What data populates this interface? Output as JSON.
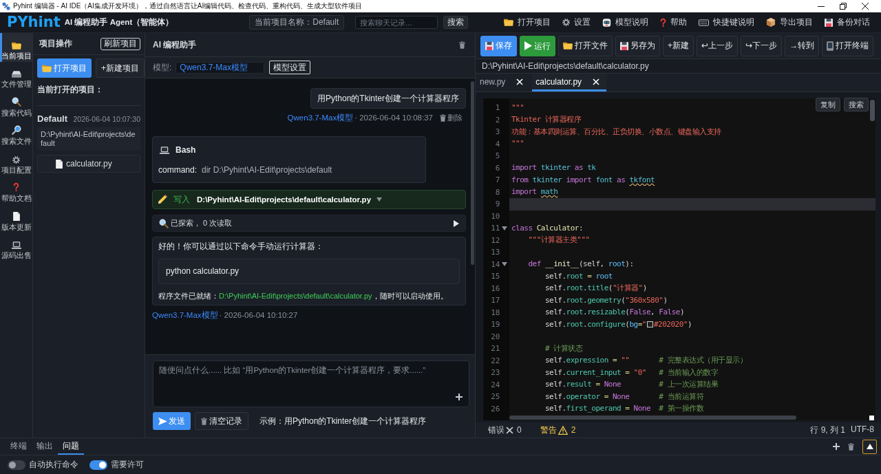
{
  "window": {
    "title": "Pyhint 编辑器 - AI IDE（AI集成开发环境），通过自然语言让AI编辑代码、检查代码、重构代码、生成大型软件项目"
  },
  "header": {
    "logo": "PYhint",
    "subtitle": "AI 编程助手 Agent（智能体）",
    "project_name": "当前项目名称：Default",
    "search": {
      "placeholder": "搜索聊天记录..."
    },
    "search_button": "搜索",
    "menu": [
      "打开项目",
      "设置",
      "模型说明",
      "帮助",
      "快捷键说明",
      "导出项目",
      "备份对话"
    ]
  },
  "sidebar": {
    "items": [
      {
        "label": "当前项目",
        "selected": true
      },
      {
        "label": "文件管理",
        "selected": false
      },
      {
        "label": "搜索代码",
        "selected": false
      },
      {
        "label": "搜索文件",
        "selected": false
      },
      {
        "label": "项目配置",
        "selected": false
      },
      {
        "label": "帮助文档",
        "selected": false
      },
      {
        "label": "版本更新",
        "selected": false
      },
      {
        "label": "源码出售",
        "selected": false
      }
    ]
  },
  "project_panel": {
    "title": "项目操作",
    "refresh_button": "刷新项目",
    "open_button": "打开项目",
    "new_button": "+新建项目",
    "current_label": "当前打开的项目：",
    "project": {
      "name": "Default",
      "time": "2026-06-04 10:07:30",
      "path": "D:\\Pyhint\\AI-Edit\\projects\\default",
      "files": [
        "calculator.py"
      ]
    }
  },
  "chat": {
    "title": "AI 编程助手",
    "model_label": "模型:",
    "model": "Qwen3.7-Max模型",
    "model_settings_button": "模型设置",
    "messages": [
      {
        "kind": "user",
        "text": "用Python的Tkinter创建一个计算器程序",
        "model": "Qwen3.7-Max模型",
        "time": "· 2026-06-04 10:08:37",
        "delete": "删除"
      },
      {
        "kind": "bash",
        "title": "Bash",
        "label": "command:",
        "command": "dir D:\\Pyhint\\AI-Edit\\projects\\default"
      },
      {
        "kind": "write",
        "action": "写入",
        "path": "D:\\Pyhint\\AI-Edit\\projects\\default\\calculator.py"
      },
      {
        "kind": "explore",
        "text": "已探索， 0 次读取"
      },
      {
        "kind": "assistant",
        "text": "好的！你可以通过以下命令手动运行计算器：",
        "code": "python calculator.py",
        "parts": [
          {
            "kind": "plain",
            "text": "程序文件已就绪："
          },
          {
            "kind": "path",
            "text": "D:\\Pyhint\\AI-Edit\\projects\\default\\calculator.py"
          },
          {
            "kind": "plain",
            "text": "，随时可以启动使用。"
          }
        ]
      },
      {
        "kind": "meta",
        "model": "Qwen3.7-Max模型",
        "time": "· 2026-06-04 10:10:27"
      }
    ],
    "input": {
      "placeholder": "随便问点什么...... 比如 “用Python的Tkinter创建一个计算器程序，要求......”"
    },
    "send_button": "发送",
    "clear_button": "清空记录",
    "example": "示例：用Python的Tkinter创建一个计算器程序"
  },
  "editor": {
    "toolbar": [
      {
        "label": "保存",
        "kind": "primary"
      },
      {
        "label": "运行",
        "kind": "run"
      },
      {
        "label": "打开文件",
        "kind": "default"
      },
      {
        "label": "另存为",
        "kind": "default"
      },
      {
        "label": "+新建",
        "kind": "default"
      },
      {
        "label": "↩上一步",
        "kind": "default"
      },
      {
        "label": "↪下一步",
        "kind": "default"
      },
      {
        "label": "→转到",
        "kind": "default"
      },
      {
        "label": "打开终端",
        "kind": "default"
      }
    ],
    "path": "D:\\Pyhint\\AI-Edit\\projects\\default\\calculator.py",
    "tabs": [
      {
        "label": "new.py",
        "selected": false
      },
      {
        "label": "calculator.py",
        "selected": true
      }
    ],
    "actions": [
      "复制",
      "搜索"
    ],
    "lines": [
      {
        "number": "1",
        "current": false,
        "fold": false,
        "tokens": [
          {
            "kind": "str",
            "text": "\"\"\""
          }
        ]
      },
      {
        "number": "2",
        "current": false,
        "fold": false,
        "tokens": [
          {
            "kind": "str",
            "text": "Tkinter 计算器程序"
          }
        ]
      },
      {
        "number": "3",
        "current": false,
        "fold": false,
        "tokens": [
          {
            "kind": "str",
            "text": "功能：基本四则运算、百分比、正负切换、小数点、键盘输入支持"
          }
        ]
      },
      {
        "number": "4",
        "current": false,
        "fold": false,
        "tokens": [
          {
            "kind": "str",
            "text": "\"\"\""
          }
        ]
      },
      {
        "number": "5",
        "current": false,
        "fold": false
      },
      {
        "number": "6",
        "current": false,
        "fold": false,
        "tokens": [
          {
            "kind": "kw",
            "text": "import"
          },
          {
            "kind": "mod",
            "text": " tkinter"
          },
          {
            "kind": "kw",
            "text": " as"
          },
          {
            "kind": "mod",
            "text": " tk"
          }
        ]
      },
      {
        "number": "7",
        "current": false,
        "fold": false,
        "tokens": [
          {
            "kind": "kw",
            "text": "from"
          },
          {
            "kind": "mod",
            "text": " tkinter"
          },
          {
            "kind": "kw",
            "text": " import"
          },
          {
            "kind": "mod",
            "text": " font"
          },
          {
            "kind": "kw",
            "text": " as "
          },
          {
            "kind": "warn",
            "text": "tkfont"
          }
        ]
      },
      {
        "number": "8",
        "current": false,
        "fold": false,
        "tokens": [
          {
            "kind": "kw",
            "text": "import "
          },
          {
            "kind": "warn",
            "text": "math"
          }
        ]
      },
      {
        "number": "9",
        "current": true,
        "fold": false
      },
      {
        "number": "10",
        "current": false,
        "fold": false
      },
      {
        "number": "11",
        "current": false,
        "fold": true,
        "tokens": [
          {
            "kind": "kw",
            "text": "class"
          },
          {
            "kind": "cls",
            "text": " Calculator"
          },
          {
            "kind": "plain",
            "text": ":"
          }
        ]
      },
      {
        "number": "12",
        "current": false,
        "fold": false,
        "tokens": [
          {
            "kind": "str",
            "text": "    \"\"\"计算器主类\"\"\""
          }
        ]
      },
      {
        "number": "13",
        "current": false,
        "fold": false
      },
      {
        "number": "14",
        "current": false,
        "fold": true,
        "tokens": [
          {
            "kind": "kw",
            "text": "    def"
          },
          {
            "kind": "fn",
            "text": " __init__"
          },
          {
            "kind": "plain",
            "text": "(self, "
          },
          {
            "kind": "param",
            "text": "root"
          },
          {
            "kind": "plain",
            "text": "):"
          }
        ]
      },
      {
        "number": "15",
        "current": false,
        "fold": false,
        "tokens": [
          {
            "kind": "self",
            "text": "        self"
          },
          {
            "kind": "plain",
            "text": "."
          },
          {
            "kind": "attr",
            "text": "root"
          },
          {
            "kind": "op",
            "text": " = "
          },
          {
            "kind": "param",
            "text": "root"
          }
        ]
      },
      {
        "number": "16",
        "current": false,
        "fold": false,
        "tokens": [
          {
            "kind": "self",
            "text": "        self"
          },
          {
            "kind": "plain",
            "text": "."
          },
          {
            "kind": "attr",
            "text": "root"
          },
          {
            "kind": "plain",
            "text": "."
          },
          {
            "kind": "attr",
            "text": "title"
          },
          {
            "kind": "plain",
            "text": "("
          },
          {
            "kind": "str",
            "text": "\"计算器\""
          },
          {
            "kind": "plain",
            "text": ")"
          }
        ]
      },
      {
        "number": "17",
        "current": false,
        "fold": false,
        "tokens": [
          {
            "kind": "self",
            "text": "        self"
          },
          {
            "kind": "plain",
            "text": "."
          },
          {
            "kind": "attr",
            "text": "root"
          },
          {
            "kind": "plain",
            "text": "."
          },
          {
            "kind": "attr",
            "text": "geometry"
          },
          {
            "kind": "plain",
            "text": "("
          },
          {
            "kind": "str",
            "text": "\"360x580\""
          },
          {
            "kind": "plain",
            "text": ")"
          }
        ]
      },
      {
        "number": "18",
        "current": false,
        "fold": false,
        "tokens": [
          {
            "kind": "self",
            "text": "        self"
          },
          {
            "kind": "plain",
            "text": "."
          },
          {
            "kind": "attr",
            "text": "root"
          },
          {
            "kind": "plain",
            "text": "."
          },
          {
            "kind": "attr",
            "text": "resizable"
          },
          {
            "kind": "plain",
            "text": "("
          },
          {
            "kind": "const",
            "text": "False"
          },
          {
            "kind": "plain",
            "text": ", "
          },
          {
            "kind": "const",
            "text": "False"
          },
          {
            "kind": "plain",
            "text": ")"
          }
        ]
      },
      {
        "number": "19",
        "current": false,
        "fold": false,
        "tokens": [
          {
            "kind": "self",
            "text": "        self"
          },
          {
            "kind": "plain",
            "text": "."
          },
          {
            "kind": "attr",
            "text": "root"
          },
          {
            "kind": "plain",
            "text": "."
          },
          {
            "kind": "attr",
            "text": "configure"
          },
          {
            "kind": "plain",
            "text": "("
          },
          {
            "kind": "param",
            "text": "bg"
          },
          {
            "kind": "op",
            "text": "="
          },
          {
            "kind": "str",
            "text": "\""
          },
          {
            "kind": "swatch",
            "color": "#202020"
          },
          {
            "kind": "str",
            "text": "#202020\""
          },
          {
            "kind": "plain",
            "text": ")"
          }
        ]
      },
      {
        "number": "20",
        "current": false,
        "fold": false
      },
      {
        "number": "21",
        "current": false,
        "fold": false,
        "tokens": [
          {
            "kind": "cmt",
            "text": "        # 计算状态"
          }
        ]
      },
      {
        "number": "22",
        "current": false,
        "fold": false,
        "tokens": [
          {
            "kind": "self",
            "text": "        self"
          },
          {
            "kind": "plain",
            "text": "."
          },
          {
            "kind": "attr",
            "text": "expression"
          },
          {
            "kind": "op",
            "text": " = "
          },
          {
            "kind": "str",
            "text": "\"\""
          },
          {
            "kind": "cmt",
            "text": "       # 完整表达式（用于显示）"
          }
        ]
      },
      {
        "number": "23",
        "current": false,
        "fold": false,
        "tokens": [
          {
            "kind": "self",
            "text": "        self"
          },
          {
            "kind": "plain",
            "text": "."
          },
          {
            "kind": "attr",
            "text": "current_input"
          },
          {
            "kind": "op",
            "text": " = "
          },
          {
            "kind": "str",
            "text": "\"0\""
          },
          {
            "kind": "cmt",
            "text": "   # 当前输入的数字"
          }
        ]
      },
      {
        "number": "24",
        "current": false,
        "fold": false,
        "tokens": [
          {
            "kind": "self",
            "text": "        self"
          },
          {
            "kind": "plain",
            "text": "."
          },
          {
            "kind": "attr",
            "text": "result"
          },
          {
            "kind": "op",
            "text": " = "
          },
          {
            "kind": "const",
            "text": "None"
          },
          {
            "kind": "cmt",
            "text": "         # 上一次运算结果"
          }
        ]
      },
      {
        "number": "25",
        "current": false,
        "fold": false,
        "tokens": [
          {
            "kind": "self",
            "text": "        self"
          },
          {
            "kind": "plain",
            "text": "."
          },
          {
            "kind": "attr",
            "text": "operator"
          },
          {
            "kind": "op",
            "text": " = "
          },
          {
            "kind": "const",
            "text": "None"
          },
          {
            "kind": "cmt",
            "text": "       # 当前运算符"
          }
        ]
      },
      {
        "number": "26",
        "current": false,
        "fold": false,
        "tokens": [
          {
            "kind": "self",
            "text": "        self"
          },
          {
            "kind": "plain",
            "text": "."
          },
          {
            "kind": "attr",
            "text": "first_operand"
          },
          {
            "kind": "op",
            "text": " = "
          },
          {
            "kind": "const",
            "text": "None"
          },
          {
            "kind": "cmt",
            "text": "  # 第一操作数"
          }
        ]
      }
    ],
    "status": {
      "errors_label": "错误",
      "errors": "0",
      "warnings_label": "警告",
      "warnings": "2",
      "position": "行 9, 列 1",
      "encoding": "UTF-8"
    }
  },
  "bottom_panel": {
    "tabs": [
      {
        "label": "终端",
        "selected": false
      },
      {
        "label": "输出",
        "selected": false
      },
      {
        "label": "问题",
        "selected": true
      }
    ],
    "toggles": [
      {
        "label": "自动执行命令",
        "on": false
      },
      {
        "label": "需要许可",
        "on": true
      }
    ]
  }
}
